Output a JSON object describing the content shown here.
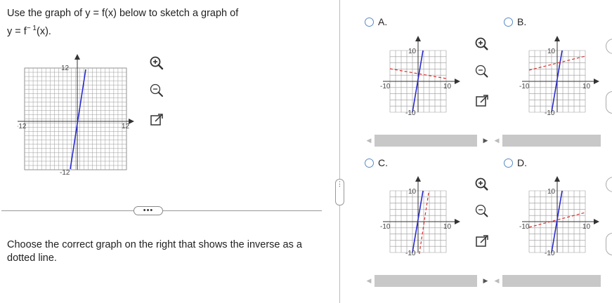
{
  "question": {
    "line1": "Use the graph of y = f(x) below to sketch a graph of",
    "line2_prefix": "y = f",
    "line2_sup": "− 1",
    "line2_suffix": "(x)."
  },
  "main_graph": {
    "x_min_label": "-12",
    "x_max_label": "12",
    "y_max_label": "12",
    "y_min_label": "-12",
    "line_color": "#2a2ad0"
  },
  "more_button": "•••",
  "splitter_label": "⋮",
  "instruction": "Choose the correct graph on the right that shows the inverse as a dotted line.",
  "options": [
    {
      "label": "A.",
      "xmin": "-10",
      "xmax": "10",
      "ymax": "10",
      "ymin": "-10"
    },
    {
      "label": "B.",
      "xmin": "-10",
      "xmax": "10",
      "ymax": "10",
      "ymin": "-10"
    },
    {
      "label": "C.",
      "xmin": "-10",
      "xmax": "10",
      "ymax": "10",
      "ymin": "-10"
    },
    {
      "label": "D.",
      "xmin": "-10",
      "xmax": "10",
      "ymax": "10",
      "ymin": "-10"
    }
  ],
  "colors": {
    "blue_line": "#2a2ad0",
    "red_dashed": "#d93030",
    "radio": "#5a8ac6"
  },
  "icons": [
    "zoom-in-icon",
    "zoom-out-icon",
    "expand-icon"
  ]
}
